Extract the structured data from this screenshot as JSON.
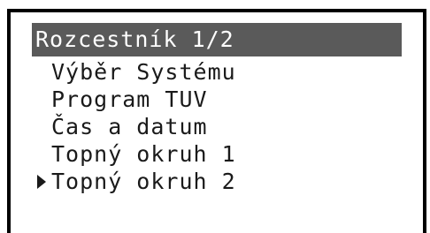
{
  "menu": {
    "title": "Rozcestník 1/2",
    "items": [
      {
        "label": "Výběr Systému",
        "selected": false
      },
      {
        "label": "Program TUV",
        "selected": false
      },
      {
        "label": "Čas a datum",
        "selected": false
      },
      {
        "label": "Topný okruh 1",
        "selected": false
      },
      {
        "label": "Topný okruh 2",
        "selected": true
      }
    ]
  },
  "colors": {
    "title_background": "#5a5a5a",
    "title_text": "#ffffff",
    "item_text": "#1a1a1a",
    "frame": "#000000"
  },
  "icons": {
    "selection_cursor": "right-triangle-cursor-icon"
  }
}
